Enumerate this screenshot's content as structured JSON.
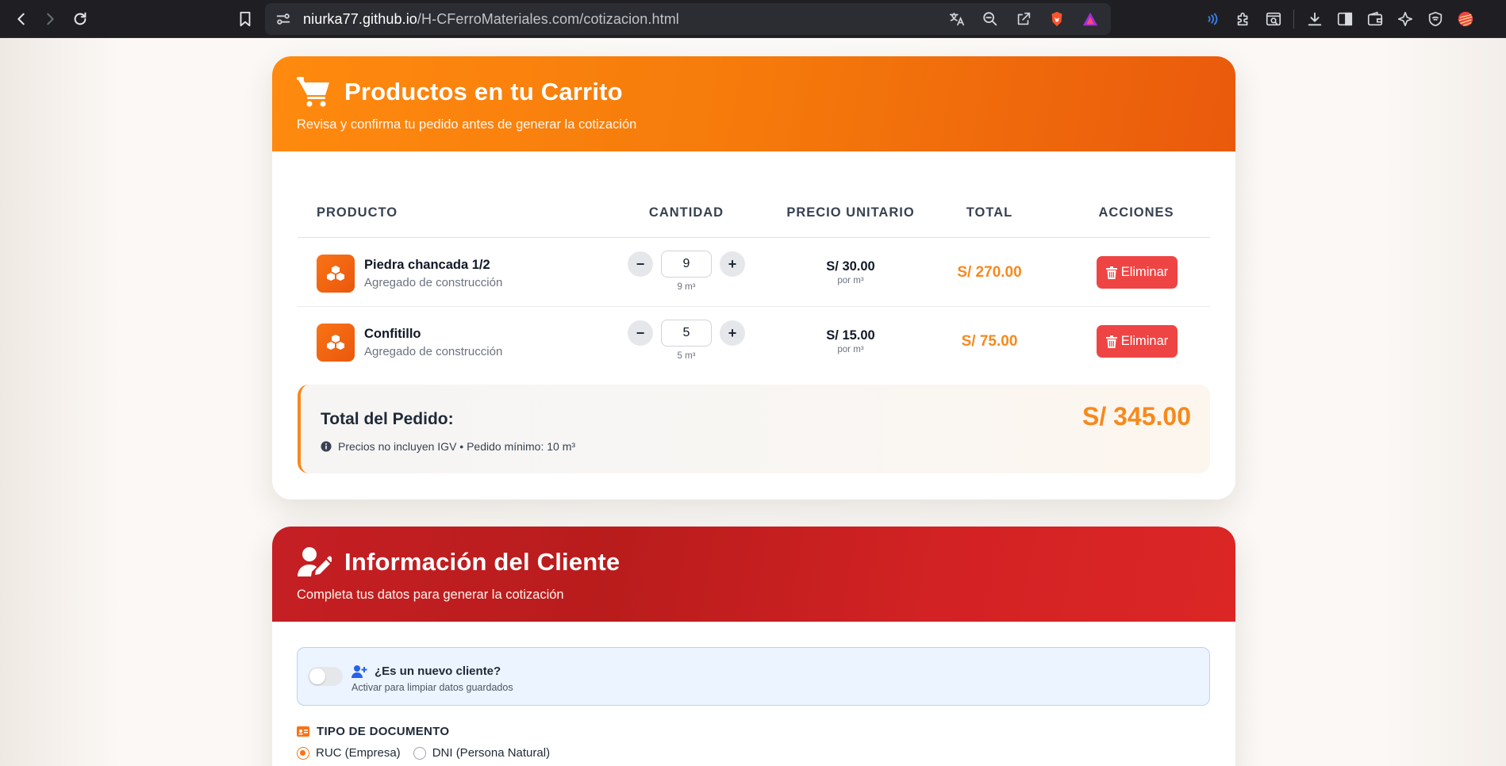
{
  "browser": {
    "url_host": "niurka77.github.io",
    "url_path": "/H-CFerroMateriales.com/cotizacion.html"
  },
  "cart": {
    "title": "Productos en tu Carrito",
    "subtitle": "Revisa y confirma tu pedido antes de generar la cotización",
    "columns": {
      "product": "PRODUCTO",
      "quantity": "CANTIDAD",
      "unit_price": "PRECIO UNITARIO",
      "total": "TOTAL",
      "actions": "ACCIONES"
    },
    "items": [
      {
        "name": "Piedra chancada 1/2",
        "category": "Agregado de construcción",
        "quantity": "9",
        "quantity_note": "9 m³",
        "unit_price": "S/ 30.00",
        "unit_label": "por m³",
        "total": "S/ 270.00",
        "delete_label": "Eliminar"
      },
      {
        "name": "Confitillo",
        "category": "Agregado de construcción",
        "quantity": "5",
        "quantity_note": "5 m³",
        "unit_price": "S/ 15.00",
        "unit_label": "por m³",
        "total": "S/ 75.00",
        "delete_label": "Eliminar"
      }
    ],
    "order_total": {
      "label": "Total del Pedido:",
      "amount": "S/ 345.00",
      "note": "Precios no incluyen IGV • Pedido mínimo: 10 m³"
    }
  },
  "client": {
    "title": "Información del Cliente",
    "subtitle": "Completa tus datos para generar la cotización",
    "new_client": {
      "title": "¿Es un nuevo cliente?",
      "subtitle": "Activar para limpiar datos guardados",
      "enabled": false
    },
    "document_type": {
      "label": "TIPO DE DOCUMENTO",
      "options": [
        "RUC (Empresa)",
        "DNI (Persona Natural)"
      ],
      "selected": "RUC (Empresa)"
    }
  },
  "colors": {
    "accent_orange": "#f7891c",
    "header_orange": "#f57a0b",
    "header_red": "#c51f24",
    "danger": "#ef4444"
  }
}
